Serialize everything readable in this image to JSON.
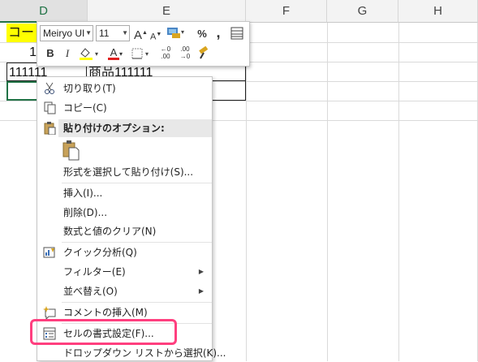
{
  "columns": [
    "D",
    "E",
    "F",
    "G",
    "H"
  ],
  "cells": {
    "d1": "コード",
    "d2": "1",
    "d3": "111111",
    "e3": "商品111111"
  },
  "mini_toolbar": {
    "font_name": "Meiryo UI",
    "font_size": "11",
    "percent": "%",
    "comma": ",",
    "bold": "B",
    "italic": "I",
    "font_color": "A",
    "grow_font": "A",
    "shrink_font": "A"
  },
  "menu": {
    "cut": "切り取り(T)",
    "copy": "コピー(C)",
    "paste_options": "貼り付けのオプション:",
    "paste_special": "形式を選択して貼り付け(S)...",
    "insert": "挿入(I)...",
    "delete": "削除(D)...",
    "clear": "数式と値のクリア(N)",
    "quick_analysis": "クイック分析(Q)",
    "filter": "フィルター(E)",
    "sort": "並べ替え(O)",
    "insert_comment": "コメントの挿入(M)",
    "format_cells": "セルの書式設定(F)...",
    "pick_from_list": "ドロップダウン リストから選択(K)..."
  },
  "colors": {
    "accent": "#217346",
    "highlight": "#ff3f7f",
    "yellow": "#ffff00"
  }
}
